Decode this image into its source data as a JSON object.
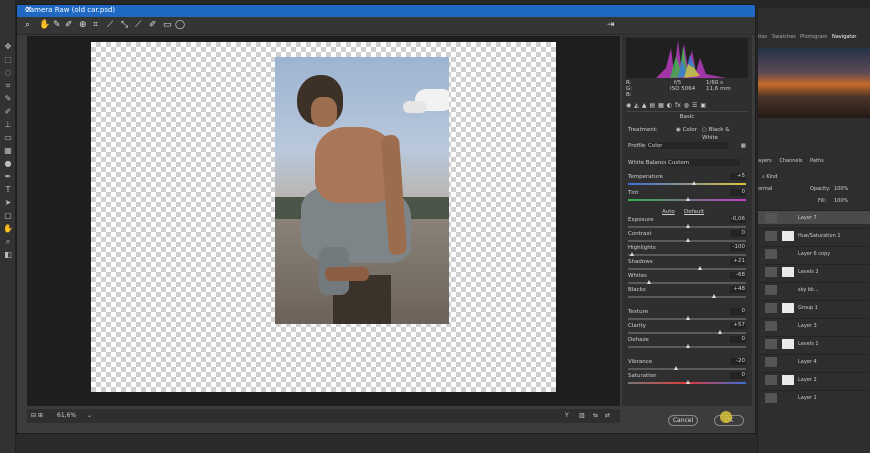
{
  "dialog": {
    "title": "Camera Raw (old car.psd)",
    "zoom": "61,6%"
  },
  "panel_tabs": [
    "ties",
    "Swatches",
    "Photogram",
    "Navigator"
  ],
  "histogram_info": {
    "r": "R:",
    "g": "G:",
    "b": "B:",
    "aperture": "f/5",
    "shutter": "1/60 s",
    "iso": "ISO 5064",
    "focal": "11,6 mm"
  },
  "basic": {
    "section": "Basic",
    "treatment_label": "Treatment:",
    "treatment_color": "Color",
    "treatment_bw": "Black & White",
    "profile_label": "Profile:",
    "profile_value": "Color",
    "wb_label": "White Balance:",
    "wb_value": "Custom",
    "auto": "Auto",
    "default": "Default",
    "rows": [
      {
        "label": "Temperature",
        "value": "+5"
      },
      {
        "label": "Tint",
        "value": "0"
      },
      {
        "label": "Exposure",
        "value": "-0,06"
      },
      {
        "label": "Contrast",
        "value": "0"
      },
      {
        "label": "Highlights",
        "value": "-100"
      },
      {
        "label": "Shadows",
        "value": "+21"
      },
      {
        "label": "Whites",
        "value": "-68"
      },
      {
        "label": "Blacks",
        "value": "+48"
      },
      {
        "label": "Texture",
        "value": "0"
      },
      {
        "label": "Clarity",
        "value": "+57"
      },
      {
        "label": "Dehaze",
        "value": "0"
      },
      {
        "label": "Vibrance",
        "value": "-20"
      },
      {
        "label": "Saturation",
        "value": "0"
      }
    ]
  },
  "buttons": {
    "cancel": "Cancel",
    "ok": "OK"
  },
  "layers_tabs": {
    "layers": "ayers",
    "channels": "Channels",
    "paths": "Paths"
  },
  "layer_options": {
    "kind": "Kind",
    "blend": "ormal",
    "opacity_label": "Opacity:",
    "opacity": "100%",
    "fill_label": "Fill:",
    "fill": "100%"
  },
  "layers": [
    "Layer 7",
    "Hue/Saturation 1",
    "Layer 6 copy",
    "Levels 2",
    "sky bk...",
    "Group 1",
    "Layer 3",
    "Levels 1",
    "Layer 4",
    "Layer 2",
    "Layer 1"
  ]
}
